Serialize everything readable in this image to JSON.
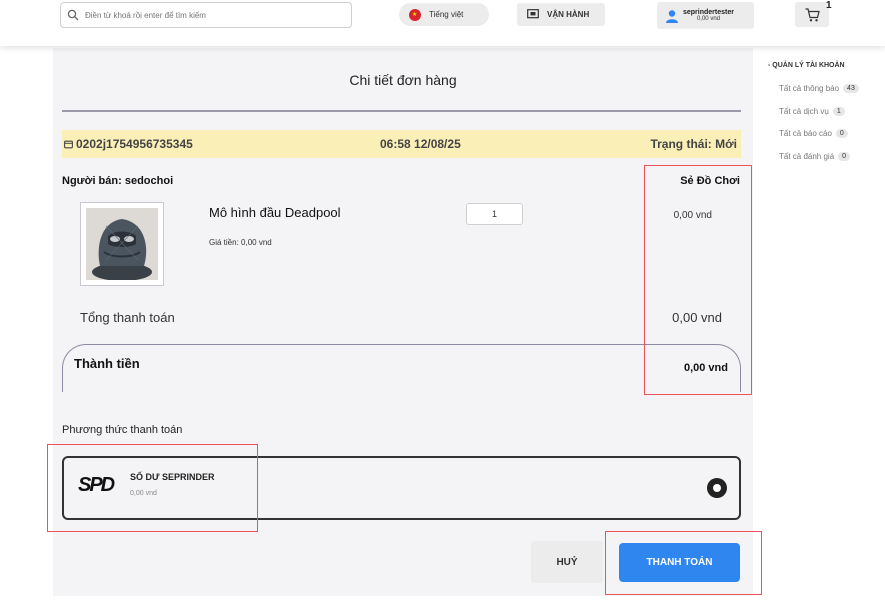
{
  "header": {
    "search_placeholder": "Điền từ khoá rồi enter để tìm kiếm",
    "language": "Tiếng việt",
    "operations": "VẬN HÀNH",
    "user": {
      "name": "seprindertester",
      "balance": "0,00 vnd"
    },
    "cart_count": "1"
  },
  "order": {
    "title": "Chi tiết đơn hàng",
    "id": "0202j1754956735345",
    "time": "06:58 12/08/25",
    "status": "Trạng thái: Mới",
    "seller_label": "Người bán:",
    "seller_name": "sedochoi",
    "shop_name": "Sẻ Đồ Chơi",
    "item": {
      "name": "Mô hình đầu Deadpool",
      "price_label": "Giá tiền:",
      "price_value": "0,00 vnd",
      "quantity": "1",
      "line_total": "0,00 vnd"
    },
    "subtotal_label": "Tổng thanh toán",
    "subtotal_value": "0,00 vnd",
    "total_label": "Thành tiền",
    "total_value": "0,00 vnd"
  },
  "payment": {
    "section_label": "Phương thức thanh toán",
    "method_logo": "SPD",
    "method_name": "SỐ DƯ SEPRINDER",
    "method_balance": "0,00 vnd",
    "selected": true
  },
  "actions": {
    "cancel": "HUỶ",
    "pay": "THANH TOÁN"
  },
  "sidebar": {
    "title": "- QUẢN LÝ TÀI KHOẢN",
    "items": [
      {
        "label": "Tất cả thông báo",
        "count": "43"
      },
      {
        "label": "Tất cả dịch vụ",
        "count": "1"
      },
      {
        "label": "Tất cả báo cáo",
        "count": "0"
      },
      {
        "label": "Tất cả đánh giá",
        "count": "0"
      }
    ]
  },
  "colors": {
    "primary": "#2f86ef",
    "order_bar": "#fbefb8",
    "annotation": "#e8545a"
  }
}
